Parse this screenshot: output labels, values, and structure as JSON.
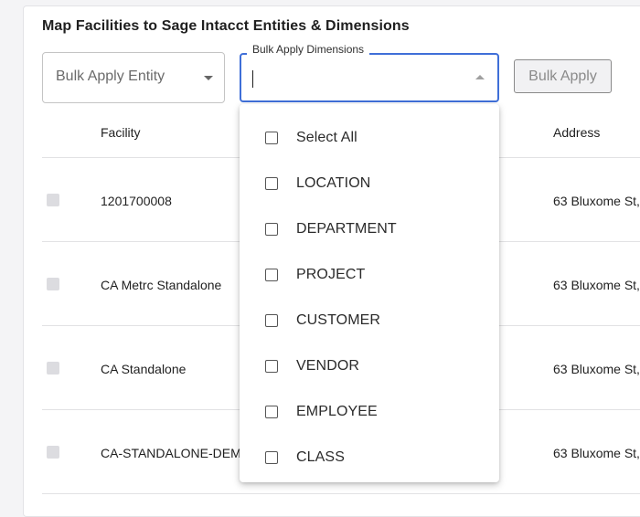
{
  "page": {
    "title": "Map Facilities to Sage Intacct Entities & Dimensions"
  },
  "controls": {
    "entity_placeholder": "Bulk Apply Entity",
    "dimensions_label": "Bulk Apply Dimensions",
    "bulk_apply_label": "Bulk Apply"
  },
  "table": {
    "columns": {
      "facility": "Facility",
      "address": "Address"
    },
    "rows": [
      {
        "facility": "1201700008",
        "address": "63 Bluxome St,"
      },
      {
        "facility": "CA Metrc Standalone",
        "address": "63 Bluxome St,"
      },
      {
        "facility": "CA Standalone",
        "address": "63 Bluxome St,"
      },
      {
        "facility": "CA-STANDALONE-DEMO",
        "address": "63 Bluxome St,"
      }
    ]
  },
  "dimensions_menu": {
    "options": [
      {
        "label": "Select All",
        "checked": false
      },
      {
        "label": "LOCATION",
        "checked": false
      },
      {
        "label": "DEPARTMENT",
        "checked": false
      },
      {
        "label": "PROJECT",
        "checked": false
      },
      {
        "label": "CUSTOMER",
        "checked": false
      },
      {
        "label": "VENDOR",
        "checked": false
      },
      {
        "label": "EMPLOYEE",
        "checked": false
      },
      {
        "label": "CLASS",
        "checked": false
      }
    ]
  },
  "colors": {
    "focus": "#3f6fd8",
    "text": "#1f1f1f",
    "muted": "#8a8a8a"
  }
}
